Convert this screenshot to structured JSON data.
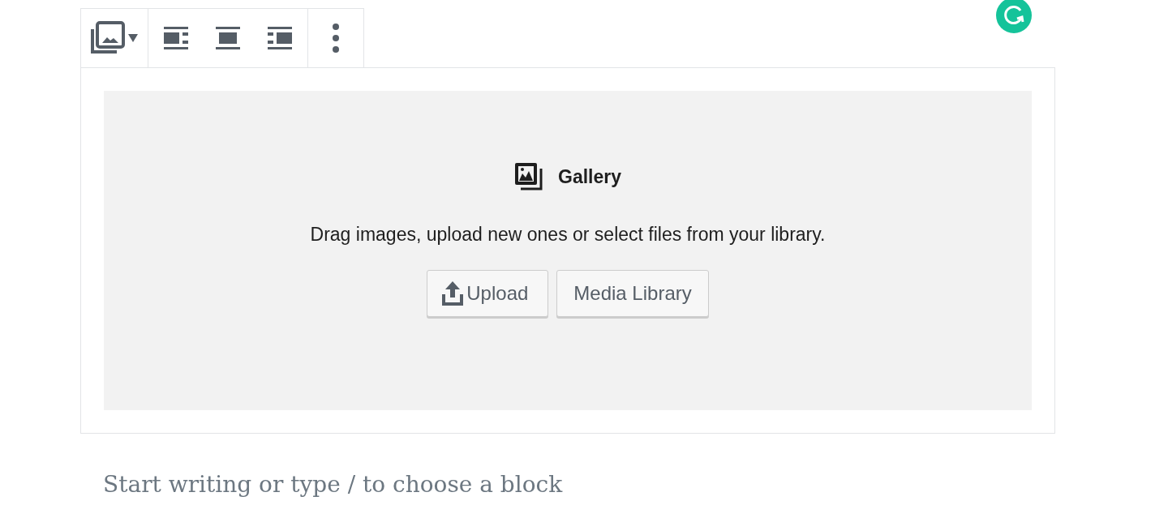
{
  "toolbar": {
    "groups": [
      {
        "items": [
          {
            "kind": "block-type"
          }
        ]
      },
      {
        "items": [
          {
            "kind": "align-left"
          },
          {
            "kind": "align-center"
          },
          {
            "kind": "align-right"
          }
        ]
      },
      {
        "items": [
          {
            "kind": "more"
          }
        ]
      }
    ]
  },
  "gallery": {
    "title": "Gallery",
    "instructions": "Drag images, upload new ones or select files from your library.",
    "buttons": [
      {
        "kind": "upload",
        "label": "Upload"
      },
      {
        "kind": "plain",
        "label": "Media Library"
      }
    ]
  },
  "editor": {
    "placeholder": "Start writing or type / to choose a block"
  }
}
